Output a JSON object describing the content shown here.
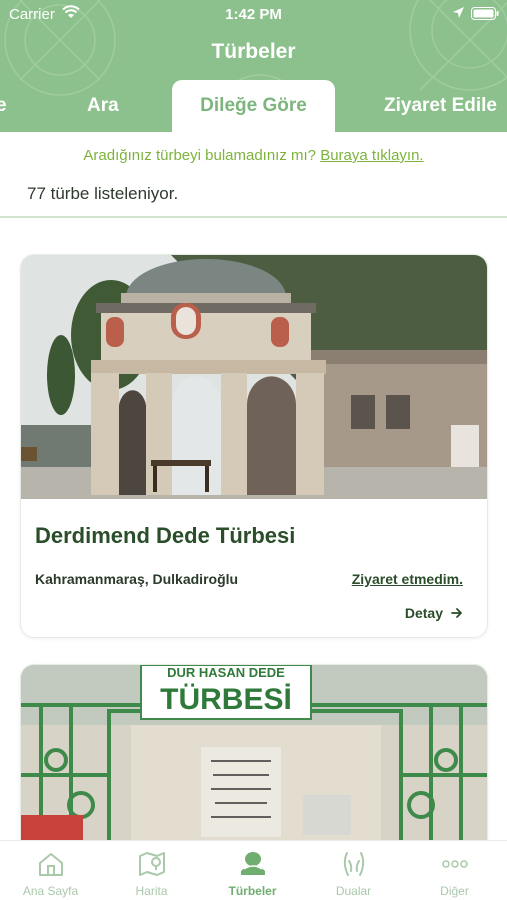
{
  "status_bar": {
    "carrier": "Carrier",
    "time": "1:42 PM"
  },
  "header": {
    "title": "Türbeler"
  },
  "tabs": [
    {
      "label": "e"
    },
    {
      "label": "Ara"
    },
    {
      "label": "Dileğe Göre"
    },
    {
      "label": "Ziyaret Edile"
    }
  ],
  "info": {
    "not_found_text": "Aradığınız türbeyi bulamadınız mı?",
    "not_found_link": "Buraya tıklayın.",
    "count_text": "77 türbe listeleniyor."
  },
  "cards": [
    {
      "name": "Derdimend Dede Türbesi",
      "location": "Kahramanmaraş, Dulkadiroğlu",
      "visit_status": "Ziyaret etmedim.",
      "detail_label": "Detay"
    },
    {
      "sign_top": "DUR HASAN DEDE",
      "sign_main": "TÜRBESİ"
    }
  ],
  "tabbar": [
    {
      "label": "Ana Sayfa",
      "icon": "home-icon"
    },
    {
      "label": "Harita",
      "icon": "map-icon"
    },
    {
      "label": "Türbeler",
      "icon": "tomb-icon"
    },
    {
      "label": "Dualar",
      "icon": "praying-hands-icon"
    },
    {
      "label": "Diğer",
      "icon": "more-icon"
    }
  ],
  "colors": {
    "header_green": "#8cc08c",
    "accent_green": "#7db67d",
    "text_dark_green": "#2a4d2a",
    "link_green": "#7db33c"
  }
}
